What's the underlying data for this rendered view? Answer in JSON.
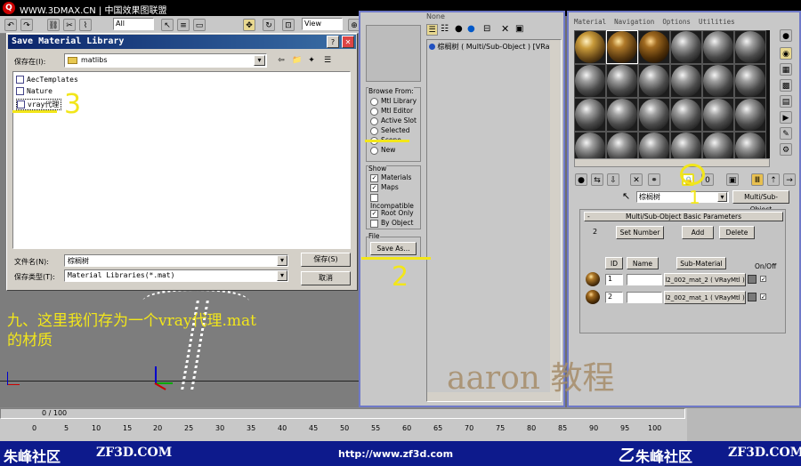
{
  "top_bar": {
    "site": "WWW.3DMAX.CN | 中国效果图联盟",
    "dropdown_all": "All",
    "dropdown_view": "View"
  },
  "dialog": {
    "title": "Save Material Library",
    "help": "?",
    "close": "✕",
    "save_in_label": "保存在(I):",
    "save_in_value": "matlibs",
    "files": [
      "AecTemplates",
      "Nature",
      "vray代理"
    ],
    "filename_label": "文件名(N):",
    "filename_value": "棕榈树",
    "filetype_label": "保存类型(T):",
    "filetype_value": "Material Libraries(*.mat)",
    "save_button": "保存(S)",
    "cancel_button": "取消"
  },
  "browser": {
    "panel_title": "None",
    "tree_item": "棕榈树 ( Multi/Sub-Object ) [VRay",
    "browse_from": {
      "title": "Browse From:",
      "options": [
        "Mtl Library",
        "Mtl Editor",
        "Active Slot",
        "Selected",
        "Scene",
        "New"
      ],
      "selected": "Scene"
    },
    "show": {
      "title": "Show",
      "items": [
        {
          "label": "Materials",
          "checked": "✓"
        },
        {
          "label": "Maps",
          "checked": "✓"
        },
        {
          "label": "Incompatible",
          "checked": ""
        }
      ],
      "root_only": "Root Only",
      "root_only_checked": "✓",
      "by_object": "By Object",
      "by_object_checked": ""
    },
    "file": {
      "title": "File",
      "save_as": "Save As..."
    }
  },
  "mat_editor": {
    "menu": [
      "Material",
      "Navigation",
      "Options",
      "Utilities"
    ],
    "material_name": "棕榈树",
    "material_type": "Multi/Sub-Object",
    "rollout_title": "Multi/Sub-Object Basic Parameters",
    "count": "2",
    "set_number": "Set Number",
    "add": "Add",
    "delete": "Delete",
    "col_id": "ID",
    "col_name": "Name",
    "col_sub": "Sub-Material",
    "col_onoff": "On/Off",
    "rows": [
      {
        "id": "1",
        "sub": "l2_002_mat_2 ( VRayMtl )",
        "on": "✓"
      },
      {
        "id": "2",
        "sub": "l2_002_mat_1 ( VRayMtl )",
        "on": "✓"
      }
    ]
  },
  "annotations": {
    "three": "3",
    "two": "2",
    "one": "1",
    "caption_line1": "九、这里我们存为一个vray代理.mat",
    "caption_line2": "的材质",
    "watermark": "aaron 教程"
  },
  "timeline": {
    "frame": "0 / 100",
    "ticks": [
      "0",
      "5",
      "10",
      "15",
      "20",
      "25",
      "30",
      "35",
      "40",
      "45",
      "50",
      "55",
      "60",
      "65",
      "70",
      "75",
      "80",
      "85",
      "90",
      "95",
      "100"
    ]
  },
  "footer": {
    "left_brand": "朱峰社区",
    "left_site": "ZF3D.COM",
    "url": "http://www.zf3d.com",
    "right_brand": "朱峰社区",
    "right_site": "ZF3D.COM"
  },
  "colors": {
    "annotation": "#f2e61a",
    "dialog_title": "#0a246a",
    "footer_bg": "#0d1a8c"
  }
}
